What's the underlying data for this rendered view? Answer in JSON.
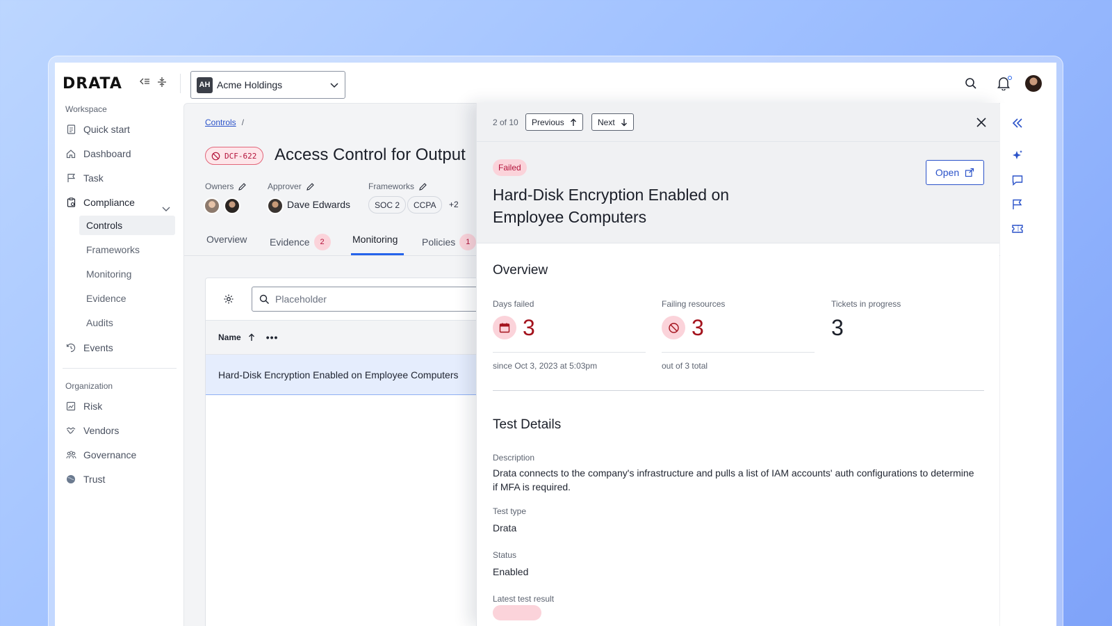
{
  "app": {
    "logo": "DRATA"
  },
  "workspace": {
    "initials": "AH",
    "name": "Acme Holdings"
  },
  "sidebar": {
    "workspace_label": "Workspace",
    "items": [
      {
        "label": "Quick start",
        "icon": "document-icon"
      },
      {
        "label": "Dashboard",
        "icon": "home-icon"
      },
      {
        "label": "Task",
        "icon": "flag-icon"
      },
      {
        "label": "Compliance",
        "icon": "clipboard-icon"
      },
      {
        "label": "Events",
        "icon": "history-icon"
      }
    ],
    "compliance_sub": [
      "Controls",
      "Frameworks",
      "Monitoring",
      "Evidence",
      "Audits"
    ],
    "organization_label": "Organization",
    "org_items": [
      {
        "label": "Risk",
        "icon": "chart-icon"
      },
      {
        "label": "Vendors",
        "icon": "handshake-icon"
      },
      {
        "label": "Governance",
        "icon": "people-icon"
      },
      {
        "label": "Trust",
        "icon": "globe-icon"
      }
    ]
  },
  "control": {
    "breadcrumb": "Controls",
    "breadcrumb_sep": "/",
    "id": "DCF-622",
    "title": "Access Control for Output",
    "owners_label": "Owners",
    "approver_label": "Approver",
    "approver_name": "Dave Edwards",
    "frameworks_label": "Frameworks",
    "frameworks": [
      "SOC 2",
      "CCPA"
    ],
    "frameworks_more": "+2",
    "tabs": [
      {
        "label": "Overview"
      },
      {
        "label": "Evidence",
        "count": "2"
      },
      {
        "label": "Monitoring"
      },
      {
        "label": "Policies",
        "count": "1"
      }
    ]
  },
  "table": {
    "search_placeholder": "Placeholder",
    "column_name": "Name",
    "rows": [
      "Hard-Disk Encryption Enabled on Employee Computers"
    ]
  },
  "panel": {
    "position": "2 of 10",
    "previous": "Previous",
    "next": "Next",
    "status": "Failed",
    "title": "Hard-Disk Encryption Enabled on Employee Computers",
    "open": "Open",
    "overview_title": "Overview",
    "stats": [
      {
        "label": "Days failed",
        "value": "3",
        "sub": "since Oct 3, 2023 at 5:03pm"
      },
      {
        "label": "Failing resources",
        "value": "3",
        "sub": "out of 3 total"
      },
      {
        "label": "Tickets in progress",
        "value": "3"
      }
    ],
    "details_title": "Test Details",
    "description_label": "Description",
    "description": "Drata connects to the company's infrastructure and pulls a list of IAM accounts' auth configurations to determine if MFA is required.",
    "test_type_label": "Test type",
    "test_type": "Drata",
    "status_label": "Status",
    "status_value": "Enabled",
    "latest_label": "Latest test result"
  },
  "colors": {
    "accent": "#2563eb",
    "danger": "#a3121c",
    "danger_bg": "#fbd3da"
  }
}
